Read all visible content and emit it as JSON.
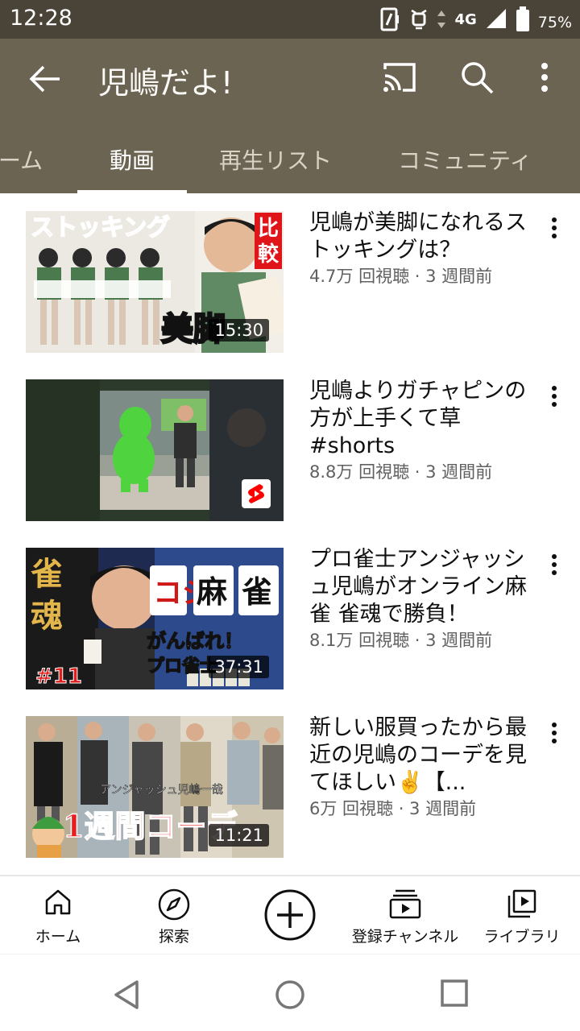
{
  "status_bar": {
    "time": "12:28",
    "network": "4G",
    "battery": "75%",
    "icons": [
      "nfc-icon",
      "alarm-icon",
      "data-arrows-icon",
      "signal-icon",
      "battery-icon"
    ]
  },
  "app_bar": {
    "title": "児嶋だよ!",
    "icons": [
      "back-arrow-icon",
      "cast-icon",
      "search-icon",
      "more-vert-icon"
    ],
    "tabs": [
      {
        "label": "ーム",
        "active": false
      },
      {
        "label": "動画",
        "active": true
      },
      {
        "label": "再生リスト",
        "active": false
      },
      {
        "label": "コミュニティ",
        "active": false
      }
    ]
  },
  "videos": [
    {
      "title": "児嶋が美脚になれるストッキングは？",
      "stats": "4.7万 回視聴 · 3 週間前",
      "duration": "15:30",
      "thumb_text": [
        "ストッキング",
        "比較",
        "美脚"
      ]
    },
    {
      "title": "児嶋よりガチャピンの方が上手くて草 #shorts",
      "stats": "8.8万 回視聴 · 3 週間前",
      "duration": ""
    },
    {
      "title": "プロ雀士アンジャッシュ児嶋がオンライン麻雀 雀魂で勝負！",
      "stats": "8.1万 回視聴 · 3 週間前",
      "duration": "37:31",
      "thumb_text": [
        "雀魂",
        "コジ",
        "麻",
        "雀",
        "がんばれ！",
        "プロ雀士",
        "#11"
      ]
    },
    {
      "title": "新しい服買ったから最近の児嶋のコーデを見てほしい✌️【...",
      "stats": "6万 回視聴 · 3 週間前",
      "duration": "11:21",
      "thumb_text": [
        "アンジャッシュ児嶋一哉",
        "1週間コーデ"
      ]
    }
  ],
  "bottom_nav": [
    {
      "label": "ホーム",
      "icon": "home-icon"
    },
    {
      "label": "探索",
      "icon": "explore-icon"
    },
    {
      "label": "",
      "icon": "create-plus-icon"
    },
    {
      "label": "登録チャンネル",
      "icon": "subscriptions-icon"
    },
    {
      "label": "ライブラリ",
      "icon": "library-icon"
    }
  ],
  "colors": {
    "header_bg": "#6c6453",
    "status_bg": "#4a4337",
    "shorts_red": "#ff0000"
  }
}
